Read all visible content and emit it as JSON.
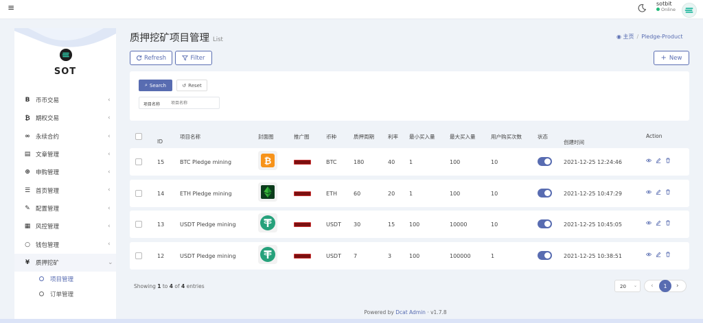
{
  "topbar": {
    "user_name": "sotbit",
    "user_status": "Online"
  },
  "sidebar": {
    "brand": "SOT",
    "items": [
      {
        "icon": "B",
        "label": "币币交易"
      },
      {
        "icon": "₿",
        "label": "期权交易"
      },
      {
        "icon": "∞",
        "label": "永续合约"
      },
      {
        "icon": "▤",
        "label": "文章管理"
      },
      {
        "icon": "⊕",
        "label": "申购管理"
      },
      {
        "icon": "☰",
        "label": "首页管理"
      },
      {
        "icon": "✎",
        "label": "配置管理"
      },
      {
        "icon": "▦",
        "label": "风控管理"
      },
      {
        "icon": "○",
        "label": "钱包管理"
      },
      {
        "icon": "¥",
        "label": "质押挖矿"
      }
    ],
    "subitems": [
      {
        "label": "项目管理"
      },
      {
        "label": "订单管理"
      }
    ]
  },
  "page": {
    "title": "质押挖矿项目管理",
    "subtitle": "List",
    "breadcrumb_home": "主页",
    "breadcrumb_current": "Pledge-Product"
  },
  "toolbar": {
    "refresh_label": "Refresh",
    "filter_label": "Filter",
    "new_label": "New"
  },
  "filter": {
    "search_label": "Search",
    "reset_label": "Reset",
    "field_label": "项目名称",
    "field_placeholder": "项目名称"
  },
  "table": {
    "headers": {
      "id": "ID",
      "name": "项目名称",
      "cover": "封面图",
      "promo": "推广图",
      "coin": "币种",
      "period": "质押周期",
      "rate": "利率",
      "min_buy": "最小买入量",
      "max_buy": "最大买入量",
      "user_times": "用户购买次数",
      "status": "状态",
      "created": "创建时间",
      "action": "Action"
    },
    "rows": [
      {
        "id": "15",
        "name": "BTC Pledge mining",
        "coin": "BTC",
        "period": "180",
        "rate": "40",
        "min_buy": "1",
        "max_buy": "100",
        "user_times": "10",
        "created": "2021-12-25 12:24:46",
        "cover_icon": "btc-logo",
        "status_on": true
      },
      {
        "id": "14",
        "name": "ETH Pledge mining",
        "coin": "ETH",
        "period": "60",
        "rate": "20",
        "min_buy": "1",
        "max_buy": "100",
        "user_times": "10",
        "created": "2021-12-25 10:47:29",
        "cover_icon": "etc-logo",
        "status_on": true
      },
      {
        "id": "13",
        "name": "USDT Pledge mining",
        "coin": "USDT",
        "period": "30",
        "rate": "15",
        "min_buy": "100",
        "max_buy": "10000",
        "user_times": "10",
        "created": "2021-12-25 10:45:05",
        "cover_icon": "usdt-logo",
        "status_on": true
      },
      {
        "id": "12",
        "name": "USDT Pledge mining",
        "coin": "USDT",
        "period": "7",
        "rate": "3",
        "min_buy": "100",
        "max_buy": "100000",
        "user_times": "1",
        "created": "2021-12-25 10:38:51",
        "cover_icon": "usdt-logo",
        "status_on": true
      }
    ]
  },
  "pagination": {
    "showing_prefix": "Showing",
    "from": "1",
    "to_word": "to",
    "to": "4",
    "of_word": "of",
    "total": "4",
    "entries_word": "entries",
    "per_page": "20",
    "current_page": "1"
  },
  "footer": {
    "powered_prefix": "Powered by",
    "powered_link": "Dcat Admin",
    "version": "v1.7.8"
  },
  "colors": {
    "accent": "#586cb1",
    "online": "#21b978"
  }
}
